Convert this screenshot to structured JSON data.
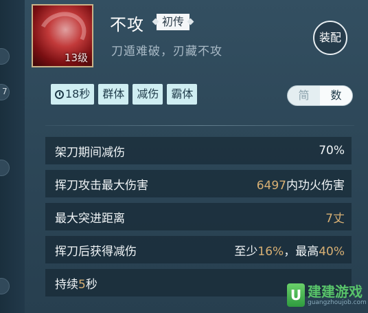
{
  "skill": {
    "name": "不攻",
    "rank": "初传",
    "level": "13级",
    "description": "刀遁难破，刃藏不攻",
    "equip_label": "装配"
  },
  "tags": [
    {
      "label": "18秒",
      "icon": "clock-icon"
    },
    {
      "label": "群体"
    },
    {
      "label": "减伤"
    },
    {
      "label": "霸体"
    }
  ],
  "mode_toggle": {
    "simple_label": "简",
    "numeric_label": "数",
    "selected": "数"
  },
  "stats": {
    "row1": {
      "label": "架刀期间减伤",
      "value": "70%"
    },
    "row2": {
      "label": "挥刀攻击最大伤害",
      "value_num": "6497",
      "value_suffix": "内功火伤害"
    },
    "row3": {
      "label": "最大突进距离",
      "value_num": "7",
      "value_suffix": "丈"
    },
    "row4": {
      "label": "挥刀后获得减伤",
      "min_prefix": "至少",
      "min_value": "16%",
      "sep": "，",
      "max_prefix": "最高",
      "max_value": "40%"
    },
    "row5": {
      "prefix": "持续",
      "value": "5",
      "suffix": "秒"
    }
  },
  "watermark": {
    "title": "建建游戏",
    "url": "guangzhoujob.com"
  },
  "colors": {
    "accent_gold": "#d8b074",
    "tag_bg": "#cfeef2",
    "panel_bg": "#2e4a5c"
  }
}
